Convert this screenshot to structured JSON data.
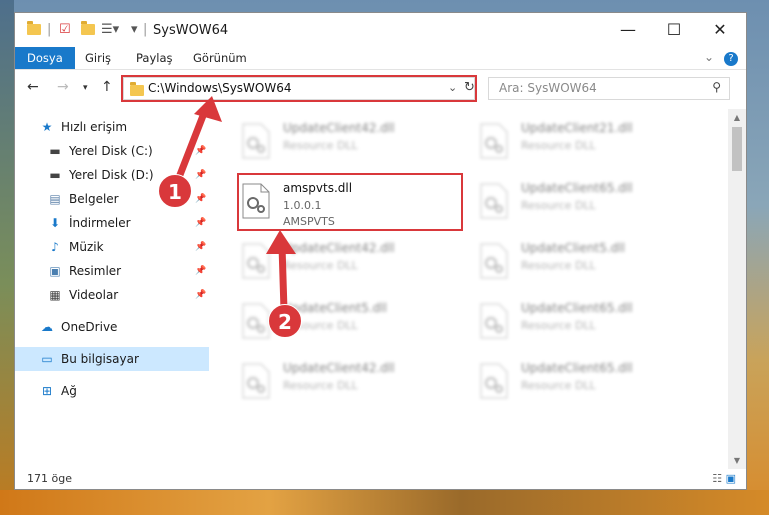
{
  "window": {
    "title": "SysWOW64",
    "controls": {
      "minimize": "—",
      "maximize": "☐",
      "close": "✕"
    }
  },
  "ribbon": {
    "tabs": [
      "Dosya",
      "Giriş",
      "Paylaş",
      "Görünüm"
    ],
    "active_tab": "Dosya"
  },
  "nav": {
    "address": "C:\\Windows\\SysWOW64",
    "search_placeholder": "Ara: SysWOW64"
  },
  "sidebar": {
    "quick_access": "Hızlı erişim",
    "pinned": [
      {
        "label": "Yerel Disk (C:)",
        "icon": "drive-icon"
      },
      {
        "label": "Yerel Disk (D:)",
        "icon": "drive-icon"
      },
      {
        "label": "Belgeler",
        "icon": "documents-icon"
      },
      {
        "label": "İndirmeler",
        "icon": "download-icon"
      },
      {
        "label": "Müzik",
        "icon": "music-icon"
      },
      {
        "label": "Resimler",
        "icon": "pictures-icon"
      },
      {
        "label": "Videolar",
        "icon": "video-icon"
      }
    ],
    "onedrive": "OneDrive",
    "this_pc": "Bu bilgisayar",
    "network": "Ağ"
  },
  "files": {
    "left_column": [
      {
        "name": "UpdateClient42.dll",
        "desc": "Resource DLL"
      },
      {
        "name": "UpdateClient42.dll",
        "desc": "Resource DLL"
      },
      {
        "name": "UpdateClient5.dll",
        "desc": "Resource DLL"
      },
      {
        "name": "UpdateClient42.dll",
        "desc": "Resource DLL"
      }
    ],
    "highlighted": {
      "name": "amspvts.dll",
      "version": "1.0.0.1",
      "company": "AMSPVTS"
    },
    "right_column": [
      {
        "name": "UpdateClient21.dll",
        "desc": "Resource DLL"
      },
      {
        "name": "UpdateClient65.dll",
        "desc": "Resource DLL"
      },
      {
        "name": "UpdateClient5.dll",
        "desc": "Resource DLL"
      },
      {
        "name": "UpdateClient65.dll",
        "desc": "Resource DLL"
      },
      {
        "name": "UpdateClient65.dll",
        "desc": "Resource DLL"
      }
    ]
  },
  "status": {
    "count": "171 öge"
  },
  "callouts": [
    "1",
    "2"
  ],
  "colors": {
    "accent": "#1979ca",
    "highlight": "#d9383b",
    "selection": "#cce8ff"
  }
}
